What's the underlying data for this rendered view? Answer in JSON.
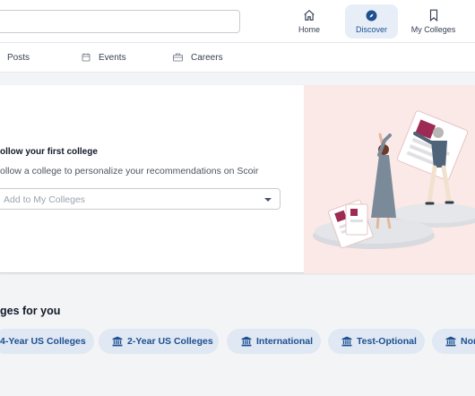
{
  "topnav": {
    "search": {
      "value": ""
    },
    "items": [
      {
        "label": "Home",
        "icon": "home-icon"
      },
      {
        "label": "Discover",
        "icon": "compass-icon",
        "active": true
      },
      {
        "label": "My Colleges",
        "icon": "bookmark-icon"
      }
    ]
  },
  "tabs": [
    {
      "label": "Posts",
      "icon": "posts-icon"
    },
    {
      "label": "Events",
      "icon": "calendar-icon"
    },
    {
      "label": "Careers",
      "icon": "briefcase-icon"
    }
  ],
  "hero": {
    "title": "ollow your first college",
    "subtitle": "ollow a college to personalize your recommendations on Scoir",
    "select": {
      "placeholder": "Add to My Colleges"
    }
  },
  "section": {
    "title": "ges for you",
    "chips": [
      {
        "label": "4-Year US Colleges",
        "icon": ""
      },
      {
        "label": "2-Year US Colleges",
        "icon": "institution-icon"
      },
      {
        "label": "International",
        "icon": "institution-icon"
      },
      {
        "label": "Test-Optional",
        "icon": "institution-icon"
      },
      {
        "label": "Non",
        "icon": "institution-icon"
      }
    ]
  },
  "colors": {
    "accent": "#1d4f91",
    "chip_bg": "#dfe8f3",
    "illustration_bg": "#fbe9e7",
    "active_nav_bg": "#e7eef7"
  }
}
